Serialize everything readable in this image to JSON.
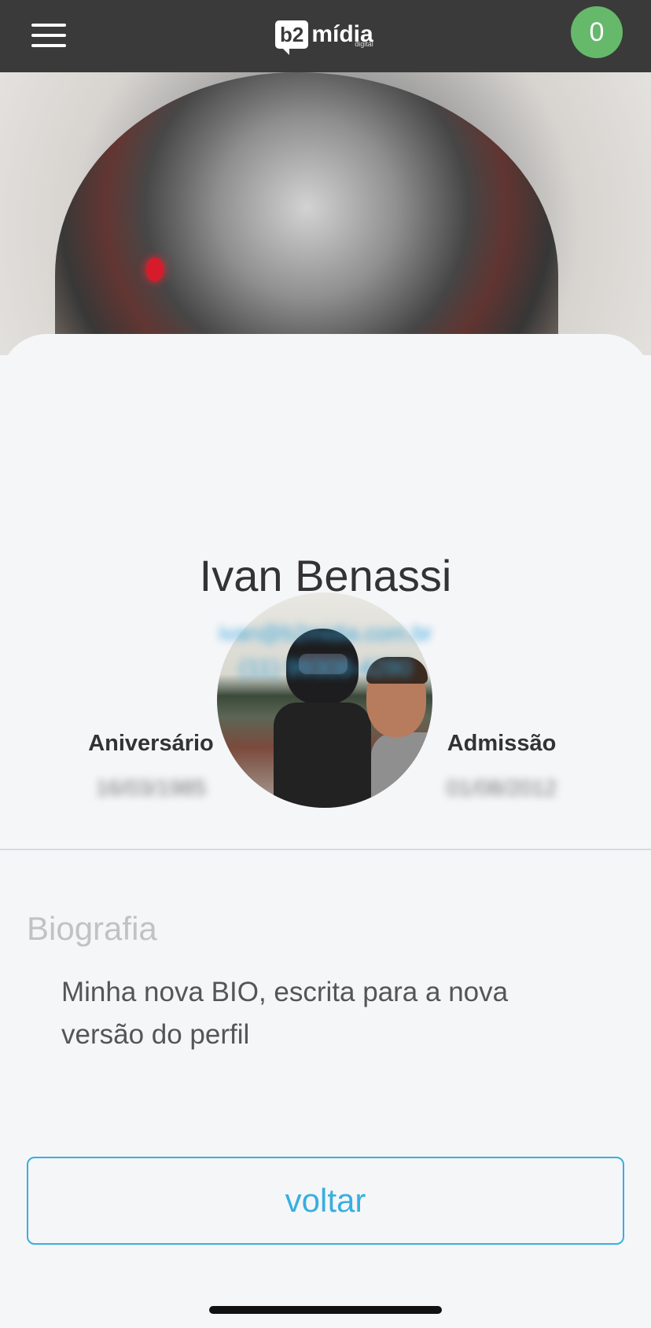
{
  "app": {
    "logo_mark": "b2",
    "logo_name": "mídia",
    "logo_sub": "digital",
    "notification_count": "0"
  },
  "header": {
    "menu_icon": "hamburger-menu-icon"
  },
  "profile": {
    "name": "Ivan Benassi",
    "email": "ivan@b2midia.com.br",
    "phone": "(11) 99308-4280",
    "birthday_label": "Aniversário",
    "birthday_value": "16/03/1985",
    "admission_label": "Admissão",
    "admission_value": "01/08/2012"
  },
  "bio": {
    "title": "Biografia",
    "text": "Minha nova BIO, escrita para a nova versão do perfil"
  },
  "actions": {
    "back_label": "voltar"
  },
  "colors": {
    "accent": "#39aee0",
    "badge": "#66b96a",
    "topbar": "#3a3a3a"
  }
}
